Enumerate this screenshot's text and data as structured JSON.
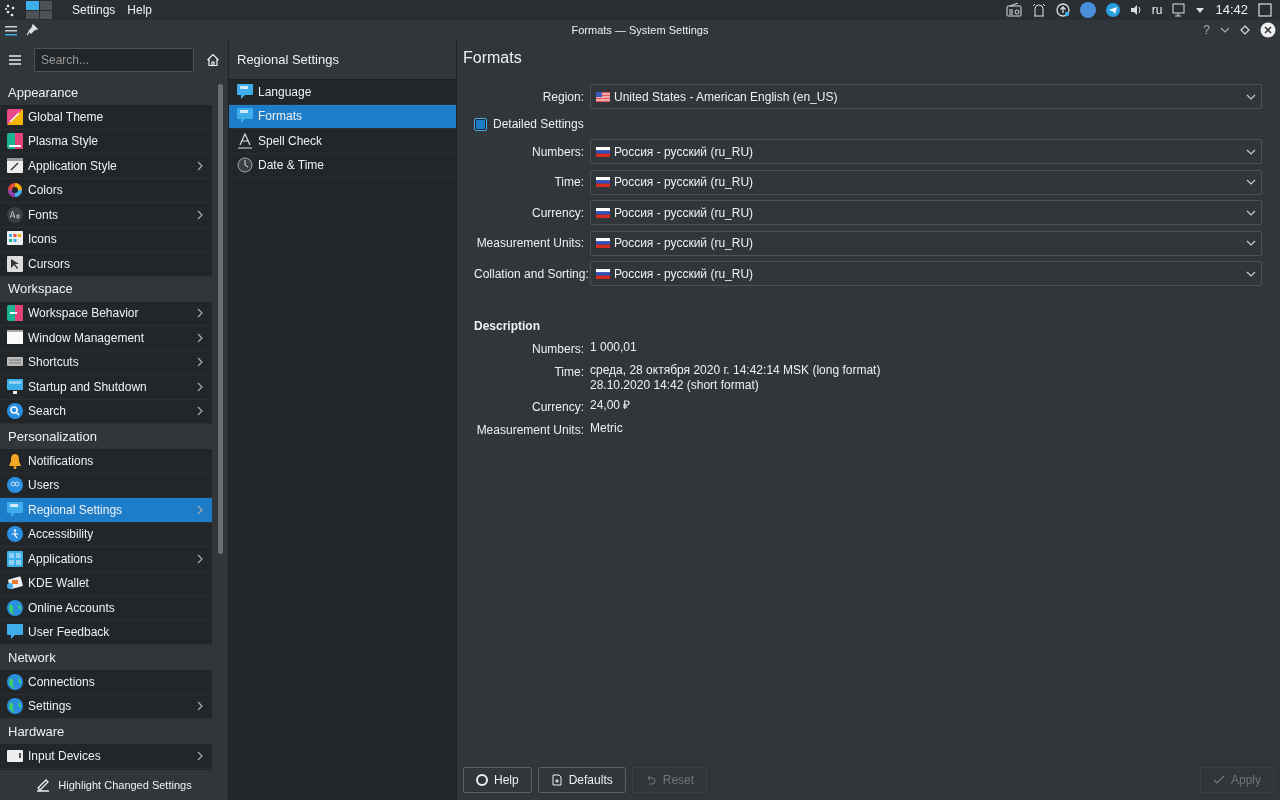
{
  "panel": {
    "menu": [
      "Settings",
      "Help"
    ],
    "keyboard_layout": "ru",
    "clock": "14:42"
  },
  "window": {
    "title": "Formats — System Settings",
    "controls": [
      "?"
    ]
  },
  "sidebar": {
    "search": {
      "placeholder": "Search..."
    },
    "items": [
      {
        "kind": "category",
        "label": "Appearance"
      },
      {
        "kind": "item",
        "label": "Global Theme",
        "has_children": false,
        "selected": false
      },
      {
        "kind": "item",
        "label": "Plasma Style",
        "has_children": false,
        "selected": false
      },
      {
        "kind": "item",
        "label": "Application Style",
        "has_children": true,
        "selected": false
      },
      {
        "kind": "item",
        "label": "Colors",
        "has_children": false,
        "selected": false
      },
      {
        "kind": "item",
        "label": "Fonts",
        "has_children": true,
        "selected": false
      },
      {
        "kind": "item",
        "label": "Icons",
        "has_children": false,
        "selected": false
      },
      {
        "kind": "item",
        "label": "Cursors",
        "has_children": false,
        "selected": false
      },
      {
        "kind": "category",
        "label": "Workspace"
      },
      {
        "kind": "item",
        "label": "Workspace Behavior",
        "has_children": true,
        "selected": false
      },
      {
        "kind": "item",
        "label": "Window Management",
        "has_children": true,
        "selected": false
      },
      {
        "kind": "item",
        "label": "Shortcuts",
        "has_children": true,
        "selected": false
      },
      {
        "kind": "item",
        "label": "Startup and Shutdown",
        "has_children": true,
        "selected": false
      },
      {
        "kind": "item",
        "label": "Search",
        "has_children": true,
        "selected": false
      },
      {
        "kind": "category",
        "label": "Personalization"
      },
      {
        "kind": "item",
        "label": "Notifications",
        "has_children": false,
        "selected": false
      },
      {
        "kind": "item",
        "label": "Users",
        "has_children": false,
        "selected": false
      },
      {
        "kind": "item",
        "label": "Regional Settings",
        "has_children": true,
        "selected": true
      },
      {
        "kind": "item",
        "label": "Accessibility",
        "has_children": false,
        "selected": false
      },
      {
        "kind": "item",
        "label": "Applications",
        "has_children": true,
        "selected": false
      },
      {
        "kind": "item",
        "label": "KDE Wallet",
        "has_children": false,
        "selected": false
      },
      {
        "kind": "item",
        "label": "Online Accounts",
        "has_children": false,
        "selected": false
      },
      {
        "kind": "item",
        "label": "User Feedback",
        "has_children": false,
        "selected": false
      },
      {
        "kind": "category",
        "label": "Network"
      },
      {
        "kind": "item",
        "label": "Connections",
        "has_children": false,
        "selected": false
      },
      {
        "kind": "item",
        "label": "Settings",
        "has_children": true,
        "selected": false
      },
      {
        "kind": "category",
        "label": "Hardware"
      },
      {
        "kind": "item",
        "label": "Input Devices",
        "has_children": true,
        "selected": false
      }
    ],
    "footer": "Highlight Changed Settings"
  },
  "subpages": {
    "title": "Regional Settings",
    "items": [
      {
        "label": "Language",
        "selected": false
      },
      {
        "label": "Formats",
        "selected": true
      },
      {
        "label": "Spell Check",
        "selected": false
      },
      {
        "label": "Date & Time",
        "selected": false
      }
    ]
  },
  "page": {
    "title": "Formats",
    "region": {
      "label": "Region:",
      "value": "United States - American English (en_US)",
      "kind": "us"
    },
    "detailed": {
      "label": "Detailed Settings",
      "checked": true
    },
    "fields": [
      {
        "label": "Numbers:",
        "value": "Россия - русский (ru_RU)",
        "kind": "ru"
      },
      {
        "label": "Time:",
        "value": "Россия - русский (ru_RU)",
        "kind": "ru"
      },
      {
        "label": "Currency:",
        "value": "Россия - русский (ru_RU)",
        "kind": "ru"
      },
      {
        "label": "Measurement Units:",
        "value": "Россия - русский (ru_RU)",
        "kind": "ru"
      },
      {
        "label": "Collation and Sorting:",
        "value": "Россия - русский (ru_RU)",
        "kind": "ru"
      }
    ],
    "description": {
      "title": "Description",
      "rows": [
        {
          "label": "Numbers:",
          "lines": [
            "1 000,01"
          ]
        },
        {
          "label": "Time:",
          "lines": [
            "среда, 28 октября 2020 г. 14:42:14 MSK (long format)",
            "28.10.2020 14:42 (short format)"
          ]
        },
        {
          "label": "Currency:",
          "lines": [
            "24,00 ₽"
          ]
        },
        {
          "label": "Measurement Units:",
          "lines": [
            "Metric"
          ]
        }
      ]
    }
  },
  "buttons": [
    {
      "label": "Help",
      "disabled": false
    },
    {
      "label": "Defaults",
      "disabled": false
    },
    {
      "label": "Reset",
      "disabled": true
    },
    {
      "label": "Apply",
      "disabled": true
    }
  ]
}
